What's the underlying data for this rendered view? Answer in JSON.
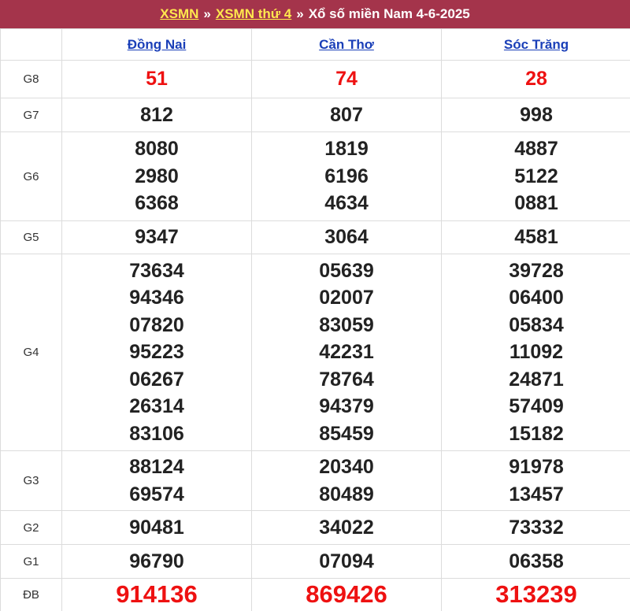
{
  "breadcrumb": {
    "link1": "XSMN",
    "sep1": "»",
    "link2": "XSMN thứ 4",
    "sep2": "»",
    "current": "Xổ số miền Nam 4-6-2025"
  },
  "provinces": [
    "Đồng Nai",
    "Cần Thơ",
    "Sóc Trăng"
  ],
  "rows": [
    {
      "label": "G8",
      "cells": [
        [
          "51"
        ],
        [
          "74"
        ],
        [
          "28"
        ]
      ]
    },
    {
      "label": "G7",
      "cells": [
        [
          "812"
        ],
        [
          "807"
        ],
        [
          "998"
        ]
      ]
    },
    {
      "label": "G6",
      "cells": [
        [
          "8080",
          "2980",
          "6368"
        ],
        [
          "1819",
          "6196",
          "4634"
        ],
        [
          "4887",
          "5122",
          "0881"
        ]
      ]
    },
    {
      "label": "G5",
      "cells": [
        [
          "9347"
        ],
        [
          "3064"
        ],
        [
          "4581"
        ]
      ]
    },
    {
      "label": "G4",
      "cells": [
        [
          "73634",
          "94346",
          "07820",
          "95223",
          "06267",
          "26314",
          "83106"
        ],
        [
          "05639",
          "02007",
          "83059",
          "42231",
          "78764",
          "94379",
          "85459"
        ],
        [
          "39728",
          "06400",
          "05834",
          "11092",
          "24871",
          "57409",
          "15182"
        ]
      ]
    },
    {
      "label": "G3",
      "cells": [
        [
          "88124",
          "69574"
        ],
        [
          "20340",
          "80489"
        ],
        [
          "91978",
          "13457"
        ]
      ]
    },
    {
      "label": "G2",
      "cells": [
        [
          "90481"
        ],
        [
          "34022"
        ],
        [
          "73332"
        ]
      ]
    },
    {
      "label": "G1",
      "cells": [
        [
          "96790"
        ],
        [
          "07094"
        ],
        [
          "06358"
        ]
      ]
    },
    {
      "label": "ĐB",
      "cells": [
        [
          "914136"
        ],
        [
          "869426"
        ],
        [
          "313239"
        ]
      ]
    }
  ],
  "colors": {
    "header_bg": "#a4344b",
    "breadcrumb_link": "#ffe84d",
    "province_link": "#1a3fb8",
    "highlight_number": "#ee1111"
  }
}
